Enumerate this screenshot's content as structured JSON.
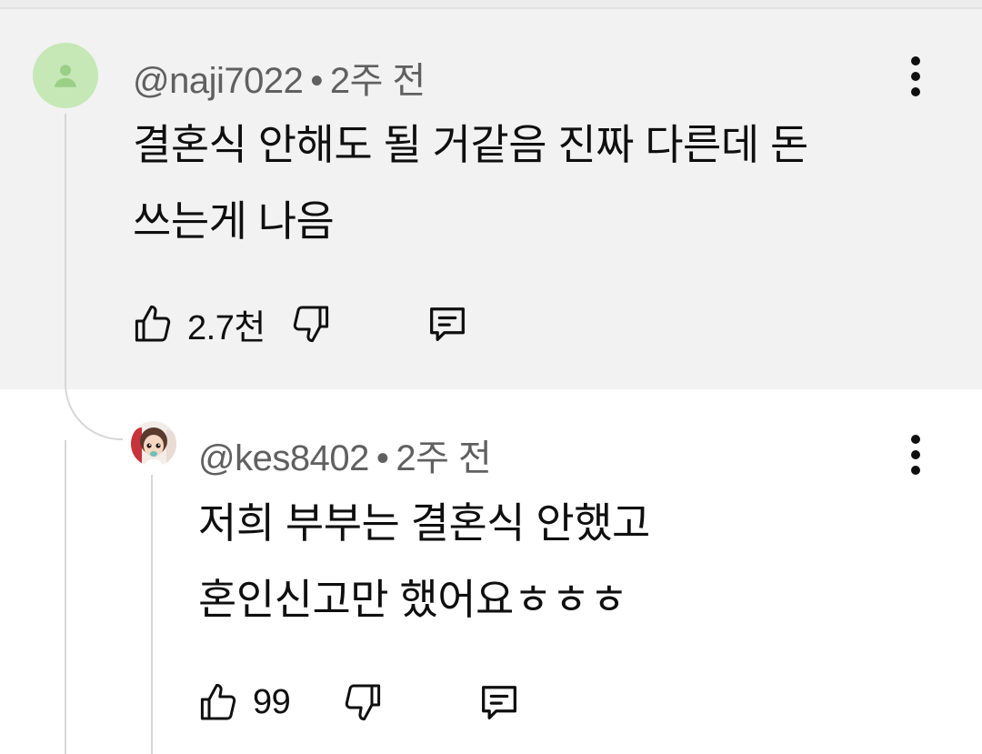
{
  "comments": [
    {
      "author": "@naji7022",
      "separator": "•",
      "time": "2주 전",
      "text_lines": [
        "결혼식 안해도 될 거같음 진짜 다른데 돈",
        "쓰는게 나음"
      ],
      "like_count": "2.7천",
      "avatar_icon": "person-icon",
      "avatar_color": "#c5e8b6"
    },
    {
      "author": "@kes8402",
      "separator": "•",
      "time": "2주 전",
      "text_lines": [
        "저희 부부는 결혼식 안했고",
        "혼인신고만 했어요ㅎㅎㅎ"
      ],
      "like_count": "99",
      "avatar_icon": "character-avatar"
    }
  ],
  "colors": {
    "highlight_bg": "#f2f2f2",
    "meta_text": "#606060",
    "text": "#0f0f0f",
    "thread_line": "#d7d7d7"
  }
}
